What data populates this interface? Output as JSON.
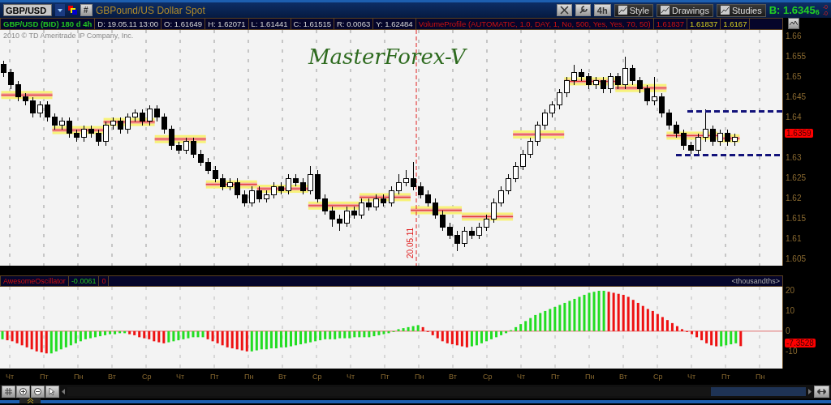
{
  "toolbar": {
    "symbol": "GBP/USD",
    "hash_button": "#",
    "description": "GBPound/US Dollar Spot",
    "timeframe": "4h",
    "buttons": [
      "Style",
      "Drawings",
      "Studies"
    ],
    "bid": "B: 1.6345$_{6}$",
    "change": [
      "-0",
      "-0"
    ]
  },
  "info_bar": [
    {
      "text": "GBP/USD (BID) 180 d 4h",
      "kind": "symbol"
    },
    {
      "text": "D: 19.05.11 13:00",
      "kind": "field"
    },
    {
      "text": "O: 1.61649",
      "kind": "field"
    },
    {
      "text": "H: 1.62071",
      "kind": "field"
    },
    {
      "text": "L: 1.61441",
      "kind": "field"
    },
    {
      "text": "C: 1.61515",
      "kind": "field"
    },
    {
      "text": "R: 0.0063",
      "kind": "field"
    },
    {
      "text": "Y: 1.62484",
      "kind": "field"
    },
    {
      "text": "VolumeProfile (AUTOMATIC, 1.0, DAY, 1, No, 500, Yes, Yes, 70, 50)",
      "kind": "study"
    },
    {
      "text": "1.61837",
      "kind": "study"
    },
    {
      "text": "1.61837",
      "kind": "level"
    },
    {
      "text": "1.6167",
      "kind": "level"
    }
  ],
  "chart": {
    "copyright": "2010 © TD Ameritrade IP Company, Inc.",
    "title": "MasterForex-V",
    "marker_date": "20.05.11",
    "last_price": "1.6359",
    "chart_data": {
      "type": "candlestick",
      "ylim": [
        1.6035,
        1.6615
      ],
      "ref_lines": [
        {
          "axis": "y",
          "value": 1.6415
        },
        {
          "axis": "y",
          "value": 1.6307
        }
      ],
      "yticks": [
        1.66,
        1.655,
        1.65,
        1.645,
        1.64,
        1.63,
        1.625,
        1.62,
        1.615,
        1.61,
        1.605
      ],
      "ohlc": [
        [
          1.653,
          1.654,
          1.65,
          1.651
        ],
        [
          1.651,
          1.652,
          1.647,
          1.648
        ],
        [
          1.648,
          1.649,
          1.644,
          1.645
        ],
        [
          1.645,
          1.646,
          1.643,
          1.644
        ],
        [
          1.644,
          1.645,
          1.64,
          1.641
        ],
        [
          1.641,
          1.644,
          1.64,
          1.643
        ],
        [
          1.643,
          1.644,
          1.639,
          1.64
        ],
        [
          1.64,
          1.641,
          1.637,
          1.638
        ],
        [
          1.638,
          1.64,
          1.637,
          1.639
        ],
        [
          1.639,
          1.64,
          1.635,
          1.636
        ],
        [
          1.636,
          1.637,
          1.634,
          1.635
        ],
        [
          1.635,
          1.638,
          1.634,
          1.637
        ],
        [
          1.637,
          1.638,
          1.635,
          1.636
        ],
        [
          1.636,
          1.637,
          1.633,
          1.634
        ],
        [
          1.634,
          1.639,
          1.633,
          1.638
        ],
        [
          1.638,
          1.64,
          1.637,
          1.639
        ],
        [
          1.639,
          1.64,
          1.636,
          1.637
        ],
        [
          1.637,
          1.641,
          1.636,
          1.64
        ],
        [
          1.64,
          1.642,
          1.639,
          1.641
        ],
        [
          1.641,
          1.642,
          1.638,
          1.639
        ],
        [
          1.639,
          1.643,
          1.638,
          1.642
        ],
        [
          1.642,
          1.643,
          1.639,
          1.64
        ],
        [
          1.64,
          1.641,
          1.636,
          1.637
        ],
        [
          1.637,
          1.638,
          1.632,
          1.633
        ],
        [
          1.633,
          1.634,
          1.631,
          1.632
        ],
        [
          1.632,
          1.635,
          1.631,
          1.634
        ],
        [
          1.634,
          1.635,
          1.63,
          1.631
        ],
        [
          1.631,
          1.632,
          1.628,
          1.629
        ],
        [
          1.629,
          1.63,
          1.626,
          1.627
        ],
        [
          1.627,
          1.628,
          1.624,
          1.625
        ],
        [
          1.625,
          1.626,
          1.622,
          1.623
        ],
        [
          1.623,
          1.625,
          1.622,
          1.624
        ],
        [
          1.624,
          1.625,
          1.62,
          1.621
        ],
        [
          1.621,
          1.622,
          1.618,
          1.619
        ],
        [
          1.619,
          1.623,
          1.618,
          1.622
        ],
        [
          1.622,
          1.623,
          1.619,
          1.62
        ],
        [
          1.62,
          1.622,
          1.619,
          1.621
        ],
        [
          1.621,
          1.624,
          1.62,
          1.623
        ],
        [
          1.623,
          1.624,
          1.621,
          1.622
        ],
        [
          1.622,
          1.626,
          1.621,
          1.625
        ],
        [
          1.625,
          1.626,
          1.623,
          1.624
        ],
        [
          1.624,
          1.625,
          1.621,
          1.622
        ],
        [
          1.622,
          1.628,
          1.621,
          1.626
        ],
        [
          1.626,
          1.627,
          1.619,
          1.62
        ],
        [
          1.62,
          1.621,
          1.616,
          1.617
        ],
        [
          1.617,
          1.618,
          1.613,
          1.615
        ],
        [
          1.615,
          1.616,
          1.612,
          1.614
        ],
        [
          1.614,
          1.618,
          1.613,
          1.617
        ],
        [
          1.617,
          1.618,
          1.615,
          1.616
        ],
        [
          1.616,
          1.62,
          1.615,
          1.619
        ],
        [
          1.619,
          1.62,
          1.617,
          1.618
        ],
        [
          1.618,
          1.621,
          1.617,
          1.62
        ],
        [
          1.62,
          1.621,
          1.618,
          1.619
        ],
        [
          1.619,
          1.623,
          1.618,
          1.622
        ],
        [
          1.622,
          1.626,
          1.621,
          1.624
        ],
        [
          1.624,
          1.627,
          1.623,
          1.625
        ],
        [
          1.625,
          1.629,
          1.622,
          1.623
        ],
        [
          1.623,
          1.624,
          1.62,
          1.621
        ],
        [
          1.621,
          1.622,
          1.618,
          1.619
        ],
        [
          1.619,
          1.62,
          1.615,
          1.616
        ],
        [
          1.616,
          1.617,
          1.612,
          1.613
        ],
        [
          1.613,
          1.614,
          1.61,
          1.611
        ],
        [
          1.611,
          1.612,
          1.607,
          1.609
        ],
        [
          1.609,
          1.613,
          1.608,
          1.612
        ],
        [
          1.612,
          1.613,
          1.61,
          1.611
        ],
        [
          1.611,
          1.614,
          1.61,
          1.613
        ],
        [
          1.613,
          1.616,
          1.612,
          1.615
        ],
        [
          1.615,
          1.62,
          1.614,
          1.619
        ],
        [
          1.619,
          1.623,
          1.618,
          1.622
        ],
        [
          1.622,
          1.626,
          1.621,
          1.625
        ],
        [
          1.625,
          1.629,
          1.624,
          1.628
        ],
        [
          1.628,
          1.632,
          1.627,
          1.631
        ],
        [
          1.631,
          1.635,
          1.63,
          1.634
        ],
        [
          1.634,
          1.639,
          1.633,
          1.638
        ],
        [
          1.638,
          1.642,
          1.637,
          1.641
        ],
        [
          1.641,
          1.644,
          1.64,
          1.643
        ],
        [
          1.643,
          1.647,
          1.642,
          1.646
        ],
        [
          1.646,
          1.65,
          1.645,
          1.649
        ],
        [
          1.649,
          1.653,
          1.648,
          1.651
        ],
        [
          1.651,
          1.652,
          1.649,
          1.65
        ],
        [
          1.65,
          1.651,
          1.647,
          1.648
        ],
        [
          1.648,
          1.65,
          1.647,
          1.649
        ],
        [
          1.649,
          1.65,
          1.646,
          1.647
        ],
        [
          1.647,
          1.651,
          1.646,
          1.65
        ],
        [
          1.65,
          1.651,
          1.647,
          1.648
        ],
        [
          1.648,
          1.655,
          1.647,
          1.652
        ],
        [
          1.652,
          1.653,
          1.648,
          1.649
        ],
        [
          1.649,
          1.65,
          1.646,
          1.647
        ],
        [
          1.647,
          1.648,
          1.643,
          1.644
        ],
        [
          1.644,
          1.65,
          1.643,
          1.645
        ],
        [
          1.645,
          1.646,
          1.64,
          1.641
        ],
        [
          1.641,
          1.642,
          1.637,
          1.638
        ],
        [
          1.638,
          1.639,
          1.635,
          1.636
        ],
        [
          1.636,
          1.637,
          1.632,
          1.633
        ],
        [
          1.633,
          1.634,
          1.631,
          1.632
        ],
        [
          1.632,
          1.636,
          1.631,
          1.635
        ],
        [
          1.635,
          1.642,
          1.634,
          1.637
        ],
        [
          1.637,
          1.638,
          1.633,
          1.634
        ],
        [
          1.634,
          1.637,
          1.633,
          1.636
        ],
        [
          1.636,
          1.637,
          1.633,
          1.634
        ],
        [
          1.634,
          1.636,
          1.633,
          1.635
        ],
        null,
        null,
        null,
        null,
        null,
        null
      ]
    }
  },
  "oscillator": {
    "header": [
      {
        "text": "AwesomeOscillator",
        "kind": "name"
      },
      {
        "text": "-0.0061",
        "kind": "value"
      },
      {
        "text": "0",
        "kind": "signal"
      }
    ],
    "units": "<thousandths>",
    "last_value": "-7.3528",
    "chart_data": {
      "type": "bar",
      "ylim": [
        -18.5,
        22
      ],
      "ref_lines": [
        {
          "axis": "y",
          "value": 0
        }
      ],
      "yticks": [
        20,
        10,
        0,
        -10
      ],
      "values": [
        -4,
        -4.5,
        -5,
        -6,
        -7,
        -8,
        -9,
        -10,
        -10.5,
        -11,
        -11,
        -10,
        -9,
        -8,
        -7,
        -6,
        -5,
        -4,
        -3.5,
        -3,
        -2.5,
        -2,
        -1.5,
        -1.5,
        -1,
        -1,
        -1.5,
        -2,
        -3,
        -3.5,
        -4,
        -5,
        -5.5,
        -6,
        -5.5,
        -5,
        -4.5,
        -4,
        -3.5,
        -3,
        -3,
        -3,
        -4,
        -5,
        -6,
        -7,
        -8,
        -8.5,
        -9,
        -9.5,
        -10,
        -10,
        -9.5,
        -9,
        -9,
        -8.5,
        -8.5,
        -8,
        -8,
        -7.5,
        -7,
        -6.5,
        -6,
        -5.5,
        -5,
        -4.5,
        -4,
        -4,
        -4,
        -3.5,
        -3.5,
        -3.5,
        -3,
        -3,
        -3,
        -3,
        -2.5,
        -2,
        -1.5,
        -1,
        0,
        1,
        1.5,
        2,
        2.5,
        3,
        2,
        0,
        -2,
        -3.5,
        -5,
        -6,
        -6.5,
        -7,
        -7.5,
        -8,
        -7.5,
        -7,
        -6,
        -5,
        -4,
        -3,
        -2,
        -1,
        0.5,
        2,
        3.5,
        5,
        6.5,
        8,
        9,
        10,
        11,
        12,
        13,
        14,
        15,
        16,
        17,
        18,
        19,
        19.5,
        20,
        20,
        19.5,
        19,
        18.5,
        18,
        17,
        15.5,
        14,
        12.5,
        11,
        10,
        8.5,
        7,
        5.5,
        4,
        2.5,
        1,
        0,
        -1.5,
        -3,
        -4.5,
        -6,
        -7,
        -7.5,
        -7.5,
        -7,
        -6.5,
        -6,
        -7.4,
        null,
        null,
        null,
        null,
        null,
        null,
        null,
        null
      ]
    }
  },
  "time_axis": [
    "Чт",
    "Пт",
    "Пн",
    "Вт",
    "Ср",
    "Чт",
    "Пт",
    "Пн",
    "Вт",
    "Ср",
    "Чт",
    "Пт",
    "Пн",
    "Вт",
    "Ср",
    "Чт",
    "Пт",
    "Пн",
    "Вт",
    "Ср",
    "Чт",
    "Пт",
    "Пн"
  ]
}
